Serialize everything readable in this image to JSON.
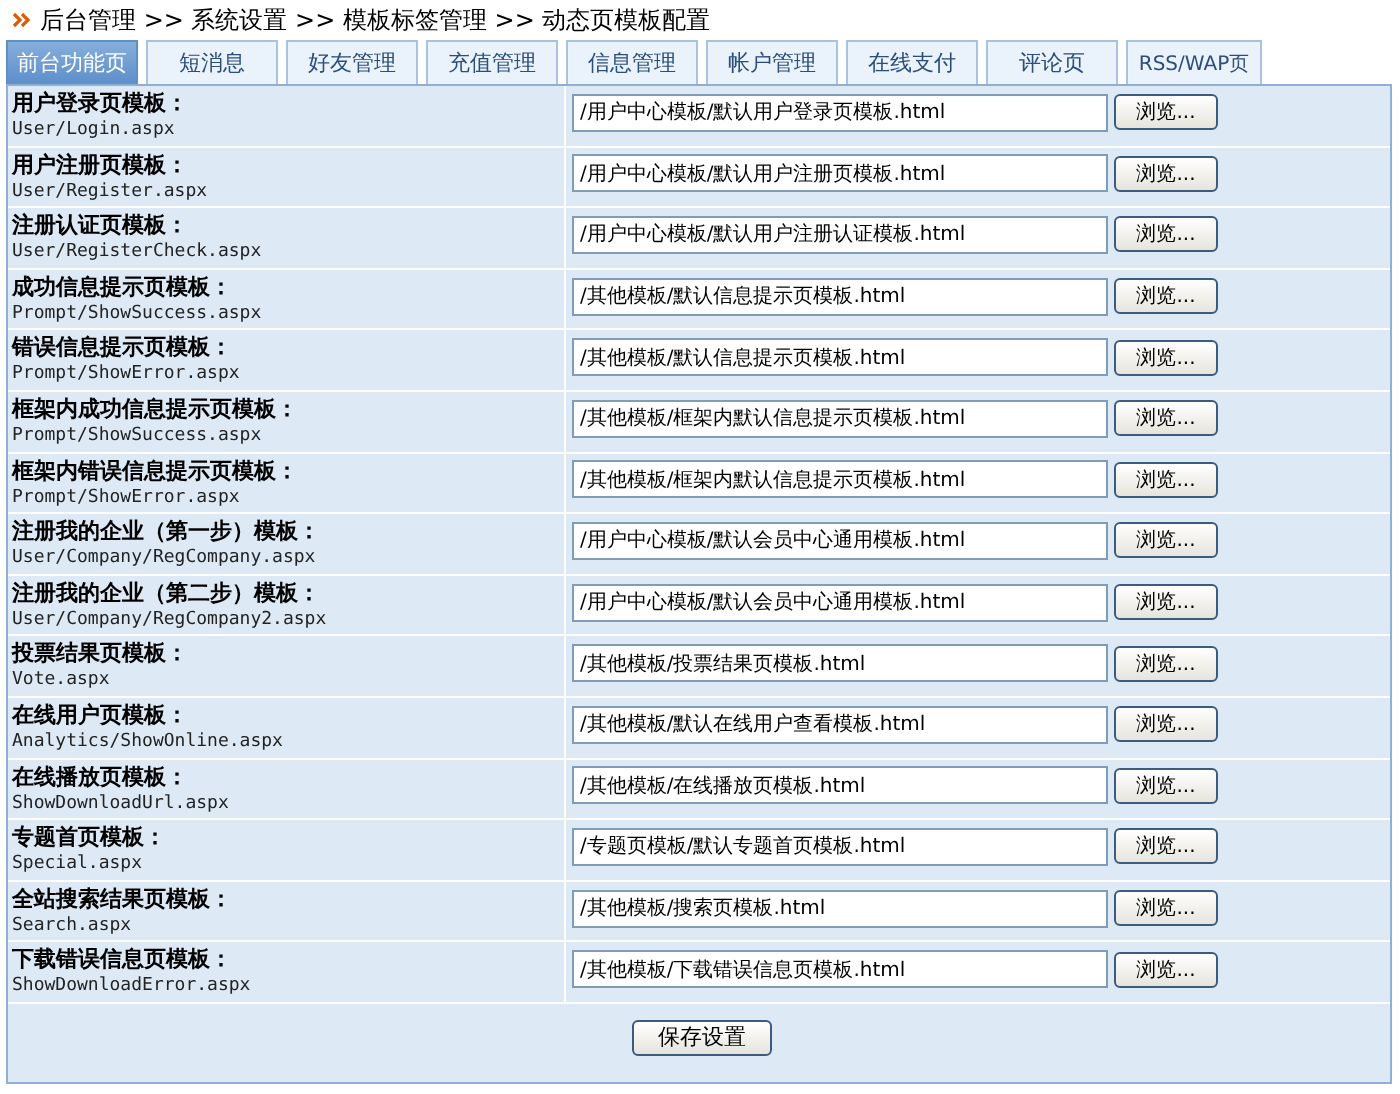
{
  "breadcrumb": "后台管理 >> 系统设置 >> 模板标签管理 >> 动态页模板配置",
  "tabs": [
    {
      "label": "前台功能页",
      "selected": true
    },
    {
      "label": "短消息",
      "selected": false
    },
    {
      "label": "好友管理",
      "selected": false
    },
    {
      "label": "充值管理",
      "selected": false
    },
    {
      "label": "信息管理",
      "selected": false
    },
    {
      "label": "帐户管理",
      "selected": false
    },
    {
      "label": "在线支付",
      "selected": false
    },
    {
      "label": "评论页",
      "selected": false
    },
    {
      "label": "RSS/WAP页",
      "selected": false
    }
  ],
  "rows": [
    {
      "title": "用户登录页模板：",
      "page": "User/Login.aspx",
      "value": "/用户中心模板/默认用户登录页模板.html",
      "button": "浏览..."
    },
    {
      "title": "用户注册页模板：",
      "page": "User/Register.aspx",
      "value": "/用户中心模板/默认用户注册页模板.html",
      "button": "浏览..."
    },
    {
      "title": "注册认证页模板：",
      "page": "User/RegisterCheck.aspx",
      "value": "/用户中心模板/默认用户注册认证模板.html",
      "button": "浏览..."
    },
    {
      "title": "成功信息提示页模板：",
      "page": "Prompt/ShowSuccess.aspx",
      "value": "/其他模板/默认信息提示页模板.html",
      "button": "浏览..."
    },
    {
      "title": "错误信息提示页模板：",
      "page": "Prompt/ShowError.aspx",
      "value": "/其他模板/默认信息提示页模板.html",
      "button": "浏览..."
    },
    {
      "title": "框架内成功信息提示页模板：",
      "page": "Prompt/ShowSuccess.aspx",
      "value": "/其他模板/框架内默认信息提示页模板.html",
      "button": "浏览..."
    },
    {
      "title": "框架内错误信息提示页模板：",
      "page": "Prompt/ShowError.aspx",
      "value": "/其他模板/框架内默认信息提示页模板.html",
      "button": "浏览..."
    },
    {
      "title": "注册我的企业（第一步）模板：",
      "page": "User/Company/RegCompany.aspx",
      "value": "/用户中心模板/默认会员中心通用模板.html",
      "button": "浏览..."
    },
    {
      "title": "注册我的企业（第二步）模板：",
      "page": "User/Company/RegCompany2.aspx",
      "value": "/用户中心模板/默认会员中心通用模板.html",
      "button": "浏览..."
    },
    {
      "title": "投票结果页模板：",
      "page": "Vote.aspx",
      "value": "/其他模板/投票结果页模板.html",
      "button": "浏览..."
    },
    {
      "title": "在线用户页模板：",
      "page": "Analytics/ShowOnline.aspx",
      "value": "/其他模板/默认在线用户查看模板.html",
      "button": "浏览..."
    },
    {
      "title": "在线播放页模板：",
      "page": "ShowDownloadUrl.aspx",
      "value": "/其他模板/在线播放页模板.html",
      "button": "浏览..."
    },
    {
      "title": "专题首页模板：",
      "page": "Special.aspx",
      "value": "/专题页模板/默认专题首页模板.html",
      "button": "浏览..."
    },
    {
      "title": "全站搜索结果页模板：",
      "page": "Search.aspx",
      "value": "/其他模板/搜索页模板.html",
      "button": "浏览..."
    },
    {
      "title": "下载错误信息页模板：",
      "page": "ShowDownloadError.aspx",
      "value": "/其他模板/下载错误信息页模板.html",
      "button": "浏览..."
    }
  ],
  "save_button": "保存设置"
}
